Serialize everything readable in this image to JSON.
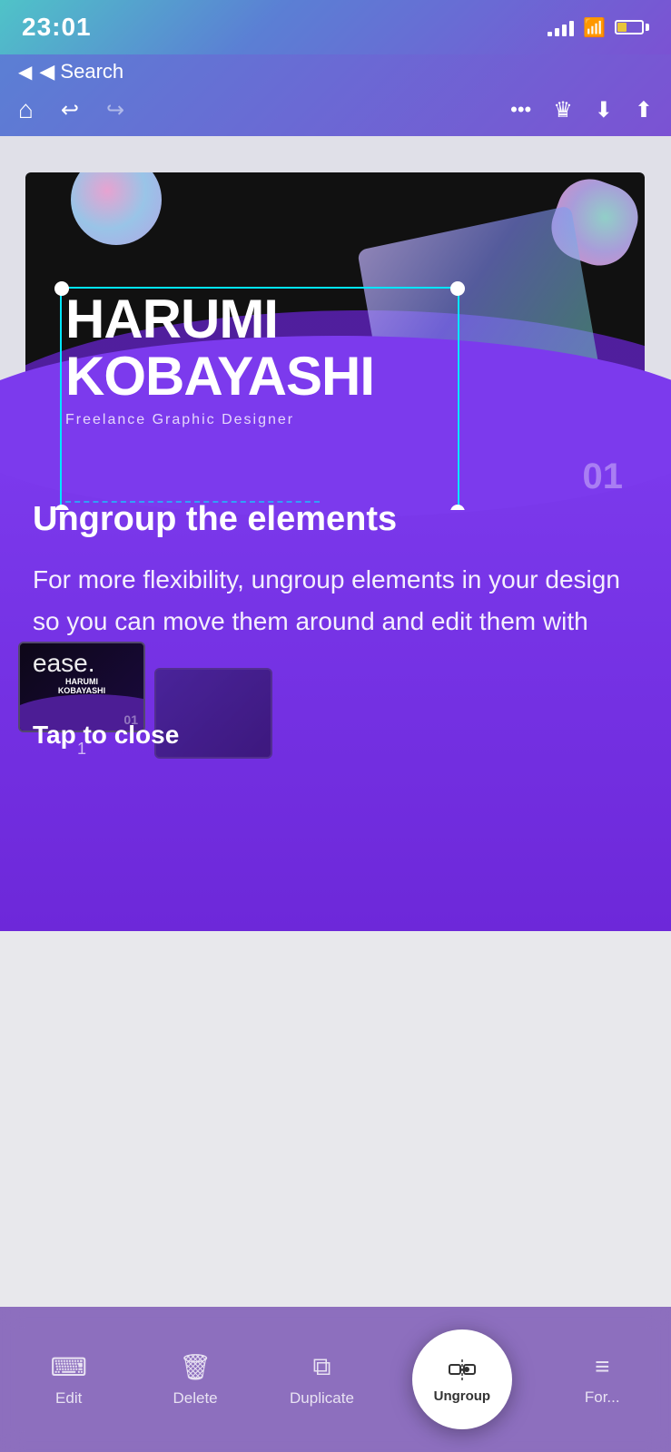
{
  "statusBar": {
    "time": "23:01",
    "signalBars": [
      4,
      8,
      12,
      16,
      20
    ],
    "wifiSymbol": "wifi",
    "batteryPercent": 25
  },
  "navbar": {
    "searchBack": "◀ Search",
    "homeLabel": "home",
    "undoLabel": "undo",
    "redoLabel": "redo",
    "moreLabel": "more",
    "crownLabel": "crown",
    "downloadLabel": "download",
    "shareLabel": "share"
  },
  "designCard": {
    "name1": "HARUMI",
    "name2": "KOBAYASHI",
    "subtitle": "Freelance Graphic Designer",
    "pageNumber": "01"
  },
  "tooltip": {
    "title": "Ungroup the elements",
    "description": "For more flexibility, ungroup elements in your design so you can move them around and edit them with ease.",
    "tapToClose": "Tap to close"
  },
  "thumbnails": [
    {
      "label": "HARUMI\nKOBAYASHI",
      "number": "01"
    }
  ],
  "pageIndicator": "1",
  "toolbar": {
    "items": [
      {
        "id": "edit",
        "label": "Edit",
        "icon": "⌨"
      },
      {
        "id": "delete",
        "label": "Delete",
        "icon": "🗑"
      },
      {
        "id": "duplicate",
        "label": "Duplicate",
        "icon": "⧉"
      },
      {
        "id": "ungroup",
        "label": "Ungroup",
        "icon": "ungroup"
      },
      {
        "id": "format",
        "label": "For...",
        "icon": "≡"
      }
    ]
  }
}
